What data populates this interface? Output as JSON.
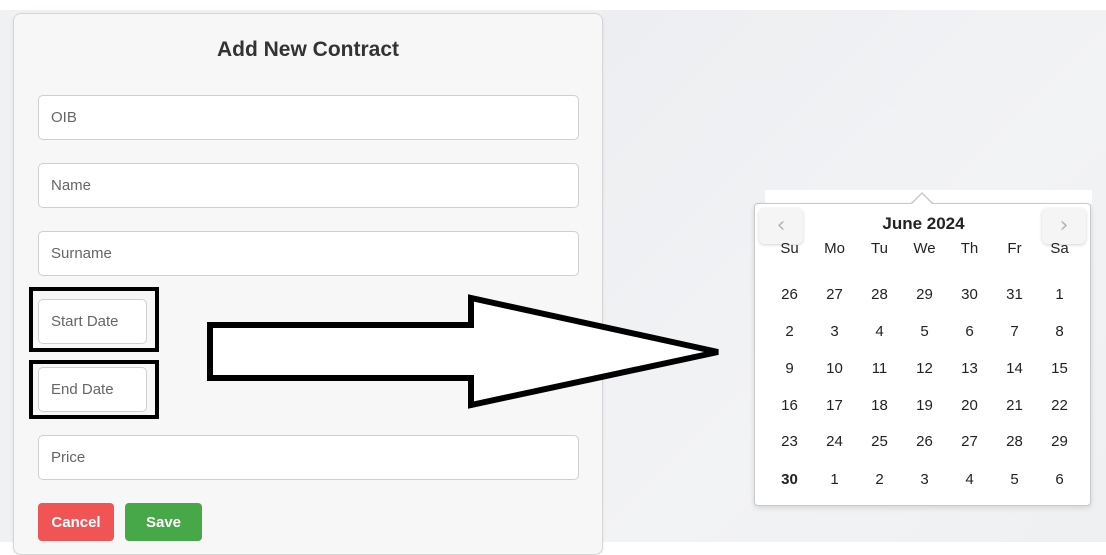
{
  "form": {
    "title": "Add New Contract",
    "fields": {
      "oib": {
        "placeholder": "OIB",
        "value": ""
      },
      "name": {
        "placeholder": "Name",
        "value": ""
      },
      "surname": {
        "placeholder": "Surname",
        "value": ""
      },
      "start_date": {
        "placeholder": "Start Date",
        "value": ""
      },
      "end_date": {
        "placeholder": "End Date",
        "value": ""
      },
      "price": {
        "placeholder": "Price",
        "value": ""
      }
    },
    "buttons": {
      "cancel": "Cancel",
      "save": "Save"
    }
  },
  "datepicker": {
    "month_label": "June 2024",
    "prev_icon": "‹",
    "next_icon": "›",
    "weekdays": [
      "Su",
      "Mo",
      "Tu",
      "We",
      "Th",
      "Fr",
      "Sa"
    ],
    "weeks": [
      [
        "26",
        "27",
        "28",
        "29",
        "30",
        "31",
        "1"
      ],
      [
        "2",
        "3",
        "4",
        "5",
        "6",
        "7",
        "8"
      ],
      [
        "9",
        "10",
        "11",
        "12",
        "13",
        "14",
        "15"
      ],
      [
        "16",
        "17",
        "18",
        "19",
        "20",
        "21",
        "22"
      ],
      [
        "23",
        "24",
        "25",
        "26",
        "27",
        "28",
        "29"
      ],
      [
        "30",
        "1",
        "2",
        "3",
        "4",
        "5",
        "6"
      ]
    ],
    "bold_day": "30"
  },
  "colors": {
    "cancel": "#f05454",
    "save": "#47a847",
    "highlight": "#000000"
  }
}
